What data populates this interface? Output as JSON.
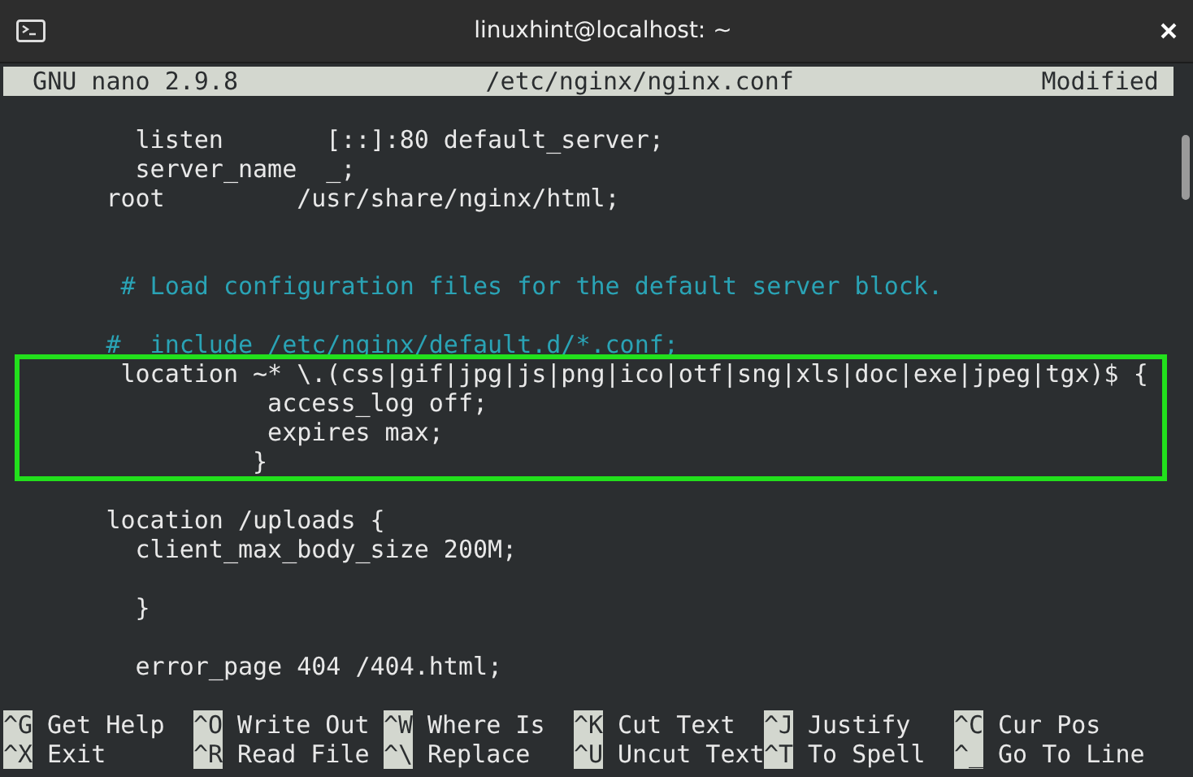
{
  "window": {
    "title": "linuxhint@localhost: ~"
  },
  "nano_header": {
    "version": "GNU nano 2.9.8",
    "file": "/etc/nginx/nginx.conf",
    "status": "Modified"
  },
  "lines": [
    {
      "kind": "blank"
    },
    {
      "kind": "code",
      "text": "         listen       [::]:80 default_server;"
    },
    {
      "kind": "code",
      "text": "         server_name  _;"
    },
    {
      "kind": "code",
      "text": "       root         /usr/share/nginx/html;"
    },
    {
      "kind": "blank"
    },
    {
      "kind": "blank"
    },
    {
      "kind": "comment",
      "text": "        # Load configuration files for the default server block."
    },
    {
      "kind": "blank"
    },
    {
      "kind": "comment",
      "text": "       #  include /etc/nginx/default.d/*.conf;"
    },
    {
      "kind": "framed_block",
      "lines": [
        {
          "kind": "code",
          "text": "        location ~* \\.(css|gif|jpg|js|png|ico|otf|sng|xls|doc|exe|jpeg|tgx)$ {"
        },
        {
          "kind": "code",
          "text": "                  access_log off;"
        },
        {
          "kind": "code",
          "text": "                  expires max;"
        },
        {
          "kind": "code",
          "text": "                 }"
        }
      ]
    },
    {
      "kind": "blank"
    },
    {
      "kind": "code",
      "text": "       location /uploads {"
    },
    {
      "kind": "code",
      "text": "         client_max_body_size 200M;"
    },
    {
      "kind": "blank"
    },
    {
      "kind": "code",
      "text": "         }"
    },
    {
      "kind": "blank"
    },
    {
      "kind": "code",
      "text": "         error_page 404 /404.html;"
    },
    {
      "kind": "blank"
    }
  ],
  "shortcuts": [
    {
      "key": "^G",
      "label": "Get Help"
    },
    {
      "key": "^O",
      "label": "Write Out"
    },
    {
      "key": "^W",
      "label": "Where Is"
    },
    {
      "key": "^K",
      "label": "Cut Text"
    },
    {
      "key": "^J",
      "label": "Justify"
    },
    {
      "key": "^C",
      "label": "Cur Pos"
    },
    {
      "key": "^X",
      "label": "Exit"
    },
    {
      "key": "^R",
      "label": "Read File"
    },
    {
      "key": "^\\",
      "label": "Replace"
    },
    {
      "key": "^U",
      "label": "Uncut Text"
    },
    {
      "key": "^T",
      "label": "To Spell"
    },
    {
      "key": "^_",
      "label": "Go To Line"
    }
  ]
}
